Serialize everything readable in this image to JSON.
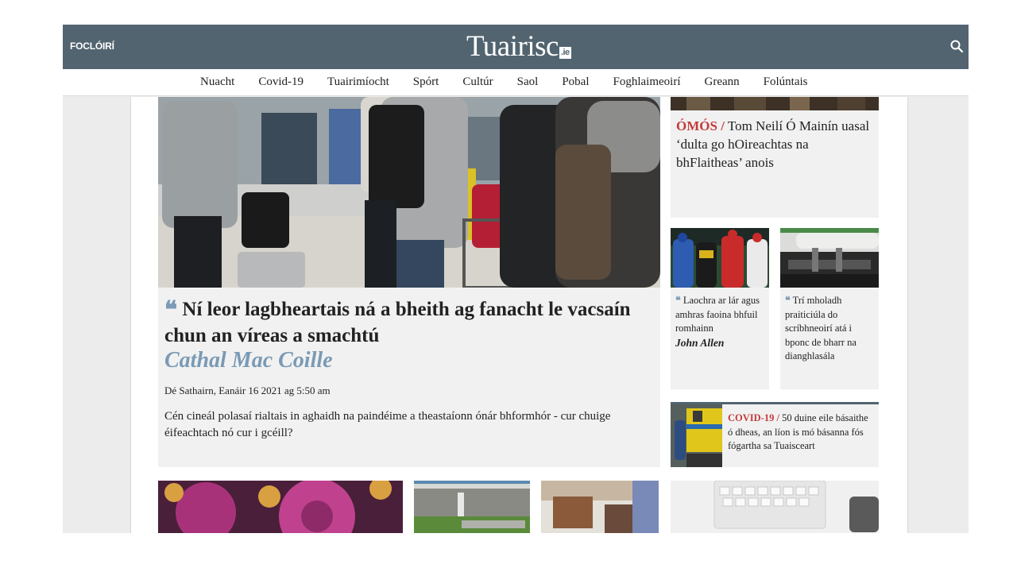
{
  "header": {
    "dictionary_link": "FOCLÓIRÍ",
    "logo_text": "Tuairisc",
    "logo_suffix": ".ie",
    "search_icon": "search-icon"
  },
  "nav": {
    "items": [
      "Nuacht",
      "Covid-19",
      "Tuairimíocht",
      "Spórt",
      "Cultúr",
      "Saol",
      "Pobal",
      "Foghlaimeoirí",
      "Greann",
      "Folúntais"
    ]
  },
  "main_story": {
    "title": "Ní leor lagbheartais ná a bheith ag fanacht le vacsaín chun an víreas a smachtú",
    "author": "Cathal Mac Coille",
    "date": "Dé Sathairn, Eanáir 16 2021 ag 5:50 am",
    "lede": "Cén cineál polasaí rialtais in aghaidh na paindéime a theastaíonn ónár bhformhór - cur chuige éifeachtach nó cur i gcéill?"
  },
  "side_top": {
    "tag": "ÓMÓS /",
    "headline": "Tom Neilí Ó Mainín uasal ‘dulta go hOireachtas na bhFlaitheas’ anois"
  },
  "small_cards": [
    {
      "headline": "Laochra ar lár agus amhras faoina bhfuil romhainn",
      "author": "John Allen"
    },
    {
      "headline": "Trí mholadh praiticiúla do scríbhneoirí atá i bponc de bharr na dianghlasála",
      "author": ""
    }
  ],
  "side_covid": {
    "tag": "COVID-19 /",
    "headline": "50 duine eile básaithe ó dheas, an líon is mó básanna fós fógartha sa Tuaisceart"
  },
  "colors": {
    "header_bg": "#526470",
    "accent_blue": "#7a9ab5",
    "tag_red": "#c53b3b",
    "card_bg": "#f1f1f1"
  }
}
